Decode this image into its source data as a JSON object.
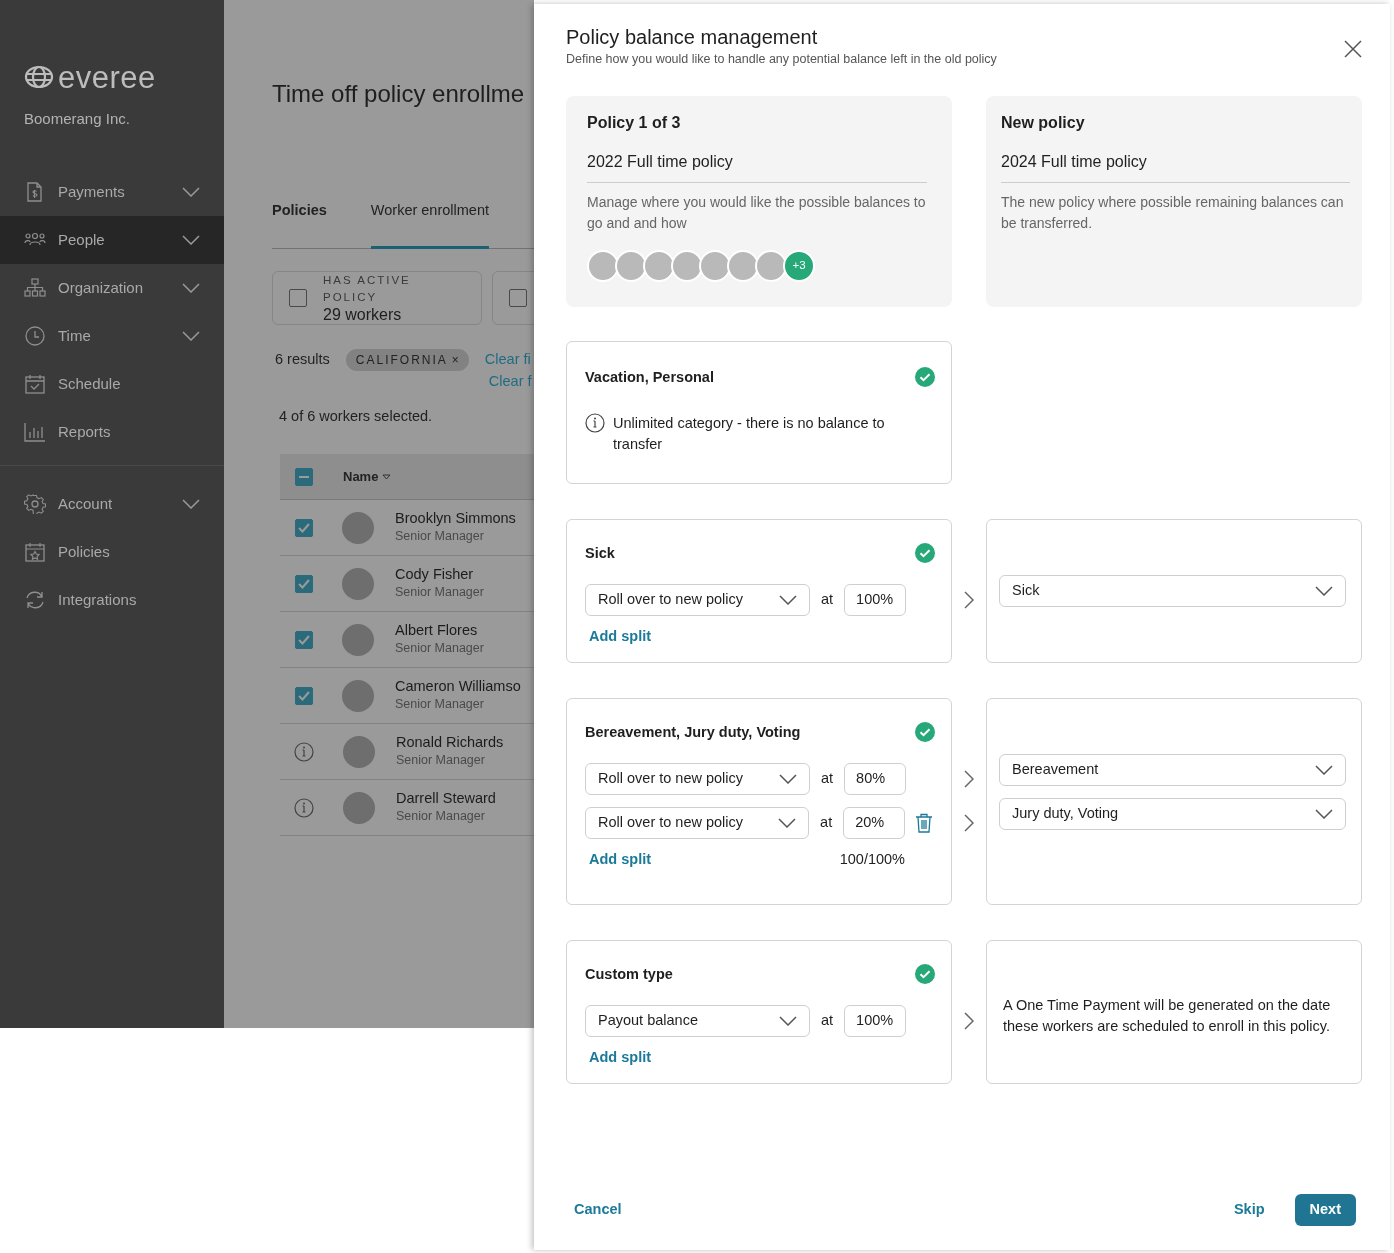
{
  "sidebar": {
    "logo_text": "everee",
    "company": "Boomerang Inc.",
    "sections": [
      [
        {
          "label": "Payments",
          "selected": false,
          "expandable": true
        },
        {
          "label": "People",
          "selected": true,
          "expandable": true
        },
        {
          "label": "Organization",
          "selected": false,
          "expandable": true
        },
        {
          "label": "Time",
          "selected": false,
          "expandable": true
        },
        {
          "label": "Schedule",
          "selected": false,
          "expandable": false
        },
        {
          "label": "Reports",
          "selected": false,
          "expandable": false
        }
      ],
      [
        {
          "label": "Account",
          "selected": false,
          "expandable": true
        },
        {
          "label": "Policies",
          "selected": false,
          "expandable": false
        },
        {
          "label": "Integrations",
          "selected": false,
          "expandable": false
        }
      ]
    ]
  },
  "page": {
    "title": "Time off policy enrollme",
    "tabs": [
      {
        "label": "Policies",
        "selected": false
      },
      {
        "label": "Worker enrollment",
        "selected": true
      }
    ],
    "filter_cards": [
      {
        "label": "HAS ACTIVE POLICY",
        "value": "29 workers",
        "checked": false
      },
      {
        "checked": false
      }
    ],
    "results": "6 results",
    "chip": {
      "label": "CALIFORNIA",
      "close": "×"
    },
    "clear_links": [
      "Clear fi",
      "Clear f"
    ],
    "selection": "4 of 6 workers selected.",
    "table": {
      "column": "Name",
      "partial": true,
      "rows": [
        {
          "name": "Brooklyn Simmons",
          "role": "Senior Manager",
          "kind": "checkbox",
          "checked": true
        },
        {
          "name": "Cody Fisher",
          "role": "Senior Manager",
          "kind": "checkbox",
          "checked": true
        },
        {
          "name": "Albert Flores",
          "role": "Senior Manager",
          "kind": "checkbox",
          "checked": true
        },
        {
          "name": "Cameron Williamso",
          "role": "Senior Manager",
          "kind": "checkbox",
          "checked": true
        },
        {
          "name": "Ronald Richards",
          "role": "Senior Manager",
          "kind": "info"
        },
        {
          "name": "Darrell Steward",
          "role": "Senior Manager",
          "kind": "info"
        }
      ]
    }
  },
  "modal": {
    "title": "Policy balance management",
    "subtitle": "Define how you would like to handle any potential balance left in the old policy",
    "old_policy": {
      "heading": "Policy 1 of 3",
      "name": "2022 Full time policy",
      "description": "Manage where you would like the possible balances to go and and how",
      "more": "+3"
    },
    "new_policy": {
      "heading": "New policy",
      "name": "2024 Full time policy",
      "description": "The new policy where possible remaining balances can be transferred."
    },
    "categories": [
      {
        "title": "Vacation, Personal",
        "done": true,
        "kind": "info",
        "note": "Unlimited category - there is no balance to transfer"
      },
      {
        "title": "Sick",
        "done": true,
        "kind": "splits",
        "splits": [
          {
            "action": "Roll over to new policy",
            "at": "at",
            "percent": "100%",
            "removable": false,
            "target": "Sick"
          }
        ],
        "add_split": "Add split"
      },
      {
        "title": "Bereavement, Jury duty, Voting",
        "done": true,
        "kind": "splits",
        "splits": [
          {
            "action": "Roll over to new policy",
            "at": "at",
            "percent": "80%",
            "removable": false,
            "target": "Bereavement"
          },
          {
            "action": "Roll over to new policy",
            "at": "at",
            "percent": "20%",
            "removable": true,
            "target": "Jury duty, Voting"
          }
        ],
        "add_split": "Add split",
        "total": "100/100%"
      },
      {
        "title": "Custom type",
        "done": true,
        "kind": "splits",
        "splits": [
          {
            "action": "Payout balance",
            "at": "at",
            "percent": "100%",
            "removable": false
          }
        ],
        "add_split": "Add split",
        "target_note": "A One Time Payment will be generated on the date these workers are scheduled to enroll in this policy."
      }
    ],
    "footer": {
      "cancel": "Cancel",
      "skip": "Skip",
      "next": "Next"
    }
  }
}
